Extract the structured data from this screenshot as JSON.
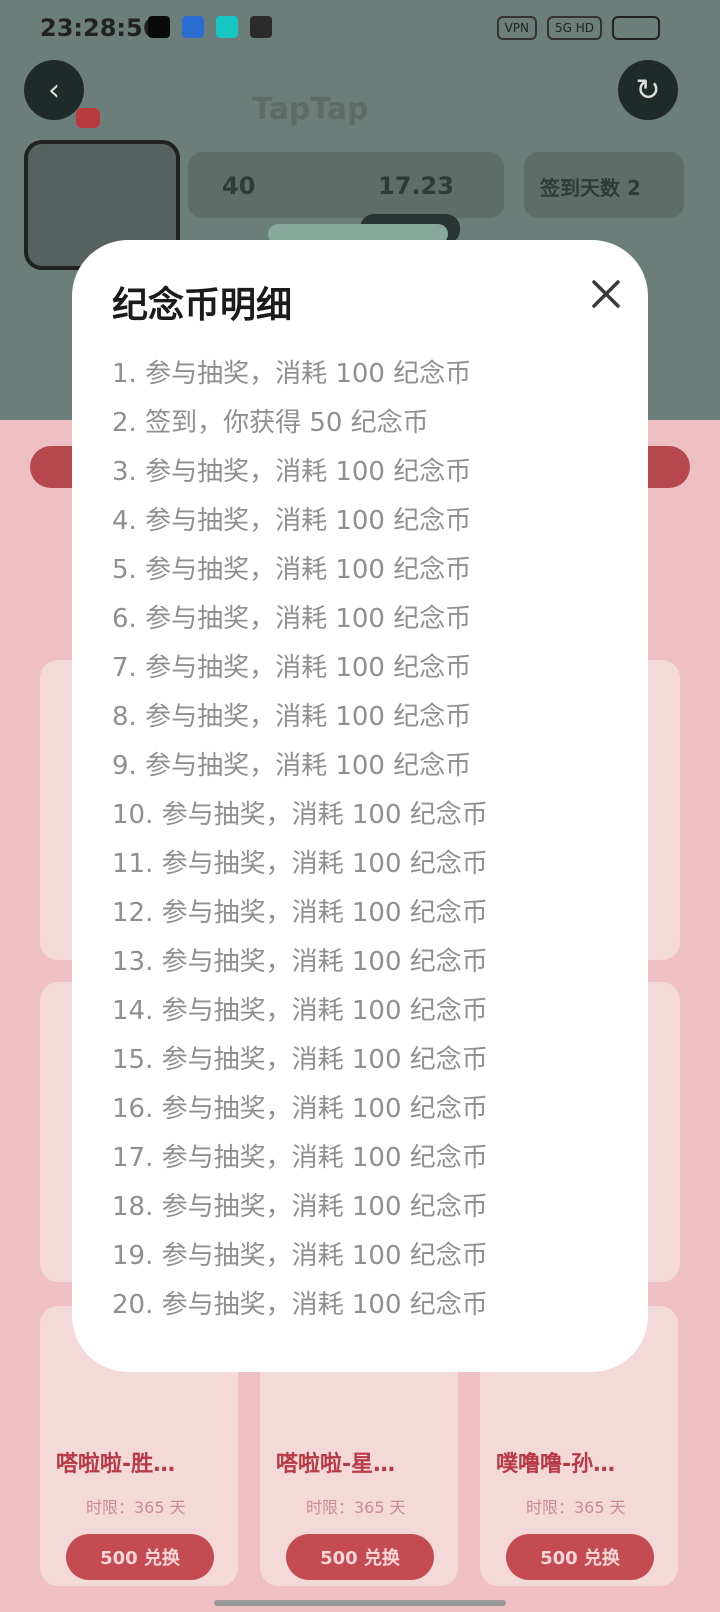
{
  "status_bar": {
    "time": "23:28:56",
    "vpn": "VPN",
    "network": "5G HD",
    "battery_percent": null
  },
  "background_app": {
    "logo": "TapTap",
    "stat_coins": "40",
    "stat_time": "17.23",
    "sign_days": "签到天数 2",
    "cards_bottom": [
      {
        "title": "嗒啦啦-胜…",
        "limit": "时限：365 天",
        "button": "500 兑换"
      },
      {
        "title": "嗒啦啦-星…",
        "limit": "时限：365 天",
        "button": "500 兑换"
      },
      {
        "title": "噗噜噜-孙…",
        "limit": "时限：365 天",
        "button": "500 兑换"
      }
    ]
  },
  "modal": {
    "title": "纪念币明细",
    "entries": [
      "1. 参与抽奖，消耗 100 纪念币",
      "2. 签到，你获得 50 纪念币",
      "3. 参与抽奖，消耗 100 纪念币",
      "4. 参与抽奖，消耗 100 纪念币",
      "5. 参与抽奖，消耗 100 纪念币",
      "6. 参与抽奖，消耗 100 纪念币",
      "7. 参与抽奖，消耗 100 纪念币",
      "8. 参与抽奖，消耗 100 纪念币",
      "9. 参与抽奖，消耗 100 纪念币",
      "10. 参与抽奖，消耗 100 纪念币",
      "11. 参与抽奖，消耗 100 纪念币",
      "12. 参与抽奖，消耗 100 纪念币",
      "13. 参与抽奖，消耗 100 纪念币",
      "14. 参与抽奖，消耗 100 纪念币",
      "15. 参与抽奖，消耗 100 纪念币",
      "16. 参与抽奖，消耗 100 纪念币",
      "17. 参与抽奖，消耗 100 纪念币",
      "18. 参与抽奖，消耗 100 纪念币",
      "19. 参与抽奖，消耗 100 纪念币",
      "20. 参与抽奖，消耗 100 纪念币"
    ]
  },
  "colors": {
    "modal_bg": "#ffffff",
    "title": "#1b1b1b",
    "entry_text": "#8f8f8f",
    "accent_red": "#c44b52"
  }
}
